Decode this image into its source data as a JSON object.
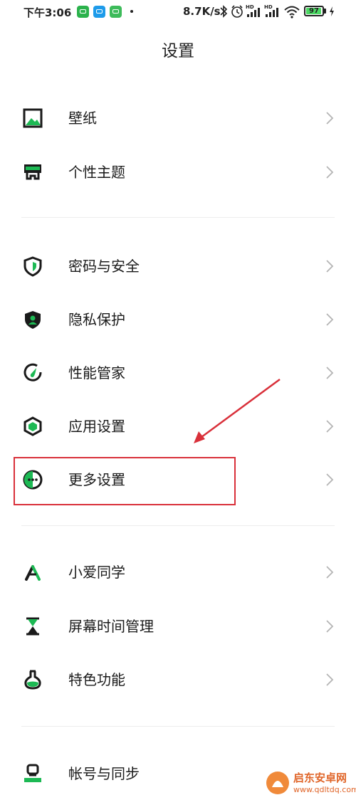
{
  "status_bar": {
    "time": "下午3:06",
    "speed": "8.7K/s",
    "battery": "97",
    "battery_level": 0.97,
    "icons": [
      "wechat-icon",
      "message-icon",
      "app-icon",
      "bluetooth-icon",
      "alarm-icon",
      "signal-hd-icon",
      "signal-hd-icon",
      "wifi-icon",
      "battery-icon",
      "charging-icon"
    ]
  },
  "header": {
    "title": "设置"
  },
  "sections": [
    {
      "items": [
        {
          "label": "壁纸",
          "icon": "wallpaper-icon"
        },
        {
          "label": "个性主题",
          "icon": "theme-icon"
        }
      ]
    },
    {
      "items": [
        {
          "label": "密码与安全",
          "icon": "shield-icon"
        },
        {
          "label": "隐私保护",
          "icon": "privacy-icon"
        },
        {
          "label": "性能管家",
          "icon": "performance-icon"
        },
        {
          "label": "应用设置",
          "icon": "hexagon-icon"
        },
        {
          "label": "更多设置",
          "icon": "more-settings-icon"
        }
      ]
    },
    {
      "items": [
        {
          "label": "小爱同学",
          "icon": "xiaoai-icon"
        },
        {
          "label": "屏幕时间管理",
          "icon": "hourglass-icon"
        },
        {
          "label": "特色功能",
          "icon": "flask-icon"
        }
      ]
    },
    {
      "items": [
        {
          "label": "帐号与同步",
          "icon": "account-icon"
        }
      ]
    }
  ],
  "watermark": {
    "name": "启东安卓网",
    "url": "www.qdltdq.com"
  },
  "colors": {
    "accent": "#1db954",
    "highlight": "#d9303a",
    "icon_dark": "#1a1a1a"
  }
}
